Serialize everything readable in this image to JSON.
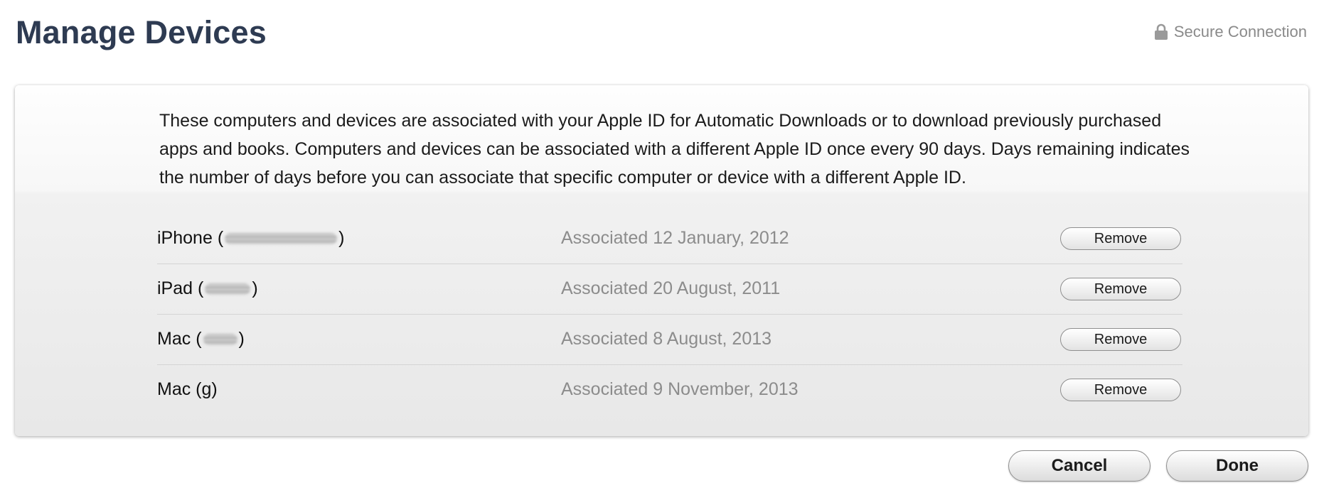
{
  "header": {
    "title": "Manage Devices",
    "secure_label": "Secure Connection",
    "secure_icon": "lock-icon"
  },
  "intro": {
    "text": "These computers and devices are associated with your Apple ID for Automatic Downloads or to download previously purchased apps and books. Computers and devices can be associated with a different Apple ID once every 90 days. Days remaining indicates the number of days before you can associate that specific computer or device with a different Apple ID."
  },
  "devices": [
    {
      "name": "iPhone",
      "open": "(",
      "redacted": "",
      "close": ")",
      "date": "Associated 12 January, 2012",
      "action": "Remove"
    },
    {
      "name": "iPad",
      "open": "(",
      "redacted": "",
      "close": ")",
      "date": "Associated 20 August, 2011",
      "action": "Remove"
    },
    {
      "name": "Mac",
      "open": "(",
      "redacted": "",
      "close": ")",
      "date": "Associated 8 August, 2013",
      "action": "Remove"
    },
    {
      "name": "Mac (g)",
      "open": "",
      "redacted": "",
      "close": "",
      "date": "Associated 9 November, 2013",
      "action": "Remove"
    }
  ],
  "footer": {
    "cancel_label": "Cancel",
    "done_label": "Done"
  },
  "colors": {
    "title": "#2e3b52",
    "muted_text": "#8c8c8c",
    "body_text": "#1b1b1b"
  }
}
